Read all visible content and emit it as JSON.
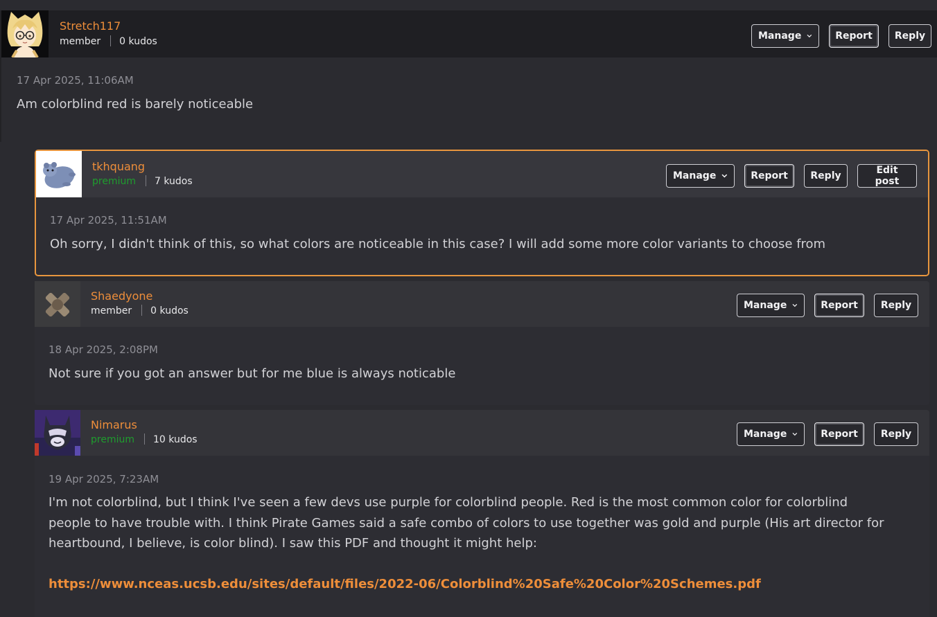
{
  "posts": [
    {
      "username": "Stretch117",
      "rank": "member",
      "kudos": "0 kudos",
      "date": "17 Apr 2025, 11:06AM",
      "body": "Am colorblind red is barely noticeable",
      "buttons": {
        "manage": "Manage",
        "report": "Report",
        "reply": "Reply"
      }
    },
    {
      "username": "tkhquang",
      "rank": "premium",
      "kudos": "7 kudos",
      "date": "17 Apr 2025, 11:51AM",
      "body": "Oh sorry, I didn't think of this, so what colors are noticeable in this case? I will add some more color variants to choose from",
      "buttons": {
        "manage": "Manage",
        "report": "Report",
        "reply": "Reply",
        "edit": "Edit post"
      }
    },
    {
      "username": "Shaedyone",
      "rank": "member",
      "kudos": "0 kudos",
      "date": "18 Apr 2025, 2:08PM",
      "body": "Not sure if you got an answer but for me blue is always noticable",
      "buttons": {
        "manage": "Manage",
        "report": "Report",
        "reply": "Reply"
      }
    },
    {
      "username": "Nimarus",
      "rank": "premium",
      "kudos": "10 kudos",
      "date": "19 Apr 2025, 7:23AM",
      "body_lines": [
        "I'm not colorblind, but I think I've seen a few devs use purple for colorblind people. Red is the most common color for colorblind",
        "people to have trouble with. I think Pirate Games said a safe combo of colors to use together was gold and purple (His art director for",
        "heartbound, I believe, is color blind). I saw this PDF and thought it might help:"
      ],
      "link": "https://www.nceas.ucsb.edu/sites/default/files/2022-06/Colorblind%20Safe%20Color%20Schemes.pdf",
      "buttons": {
        "manage": "Manage",
        "report": "Report",
        "reply": "Reply"
      }
    }
  ],
  "colors": {
    "username": "#ee8e3a",
    "premium": "#1f9d2e",
    "highlight_border": "#e8963e",
    "link": "#ee8e3a"
  },
  "icons": {
    "manage_chevron": "chevron-down-icon"
  }
}
